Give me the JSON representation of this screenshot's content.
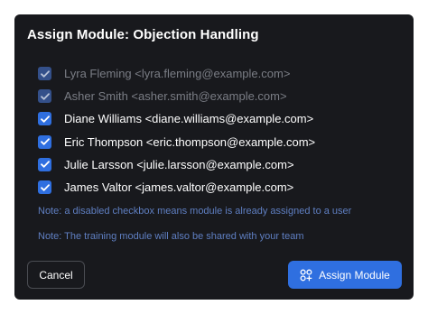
{
  "modal": {
    "title": "Assign Module: Objection Handling"
  },
  "users": [
    {
      "label": "Lyra Fleming <lyra.fleming@example.com>",
      "checked": true,
      "disabled": true
    },
    {
      "label": "Asher Smith <asher.smith@example.com>",
      "checked": true,
      "disabled": true
    },
    {
      "label": "Diane Williams <diane.williams@example.com>",
      "checked": true,
      "disabled": false
    },
    {
      "label": "Eric Thompson <eric.thompson@example.com>",
      "checked": true,
      "disabled": false
    },
    {
      "label": "Julie Larsson <julie.larsson@example.com>",
      "checked": true,
      "disabled": false
    },
    {
      "label": "James Valtor <james.valtor@example.com>",
      "checked": true,
      "disabled": false
    }
  ],
  "notes": {
    "disabled_note": "Note: a disabled checkbox means module is already assigned to a user",
    "share_note": "Note: The training module will also be shared with your team"
  },
  "buttons": {
    "cancel_label": "Cancel",
    "assign_label": "Assign Module",
    "assign_icon": "assign-users-icon"
  },
  "colors": {
    "modal_bg": "#18191d",
    "accent": "#2f6fe0",
    "note_text": "#5f7fc2",
    "disabled_text": "#7a7d85"
  }
}
